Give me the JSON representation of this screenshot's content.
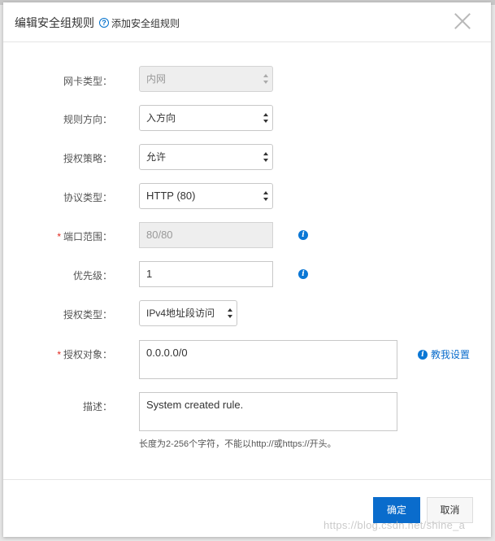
{
  "dialog": {
    "title": "编辑安全组规则",
    "help_link": "添加安全组规则",
    "help_icon": "question-circle-icon",
    "close_icon": "close-icon"
  },
  "form": {
    "nic_type": {
      "label": "网卡类型：",
      "value": "内网",
      "disabled": true
    },
    "direction": {
      "label": "规则方向：",
      "value": "入方向"
    },
    "policy": {
      "label": "授权策略：",
      "value": "允许"
    },
    "protocol": {
      "label": "协议类型：",
      "value": "HTTP (80)"
    },
    "port_range": {
      "label": "端口范围：",
      "value": "80/80",
      "required": "*",
      "disabled": true
    },
    "priority": {
      "label": "优先级：",
      "value": "1"
    },
    "auth_type": {
      "label": "授权类型：",
      "value": "IPv4地址段访问"
    },
    "auth_object": {
      "label": "授权对象：",
      "value": "0.0.0.0/0",
      "required": "*",
      "help_link": "教我设置"
    },
    "description": {
      "label": "描述：",
      "value": "System created rule.",
      "hint": "长度为2-256个字符，不能以http://或https://开头。"
    }
  },
  "footer": {
    "ok_label": "确定",
    "cancel_label": "取消"
  },
  "watermark": "https://blog.csdn.net/shine_a",
  "colors": {
    "primary": "#0a6ccc",
    "required": "#e0281e",
    "info": "#0a77d5"
  }
}
